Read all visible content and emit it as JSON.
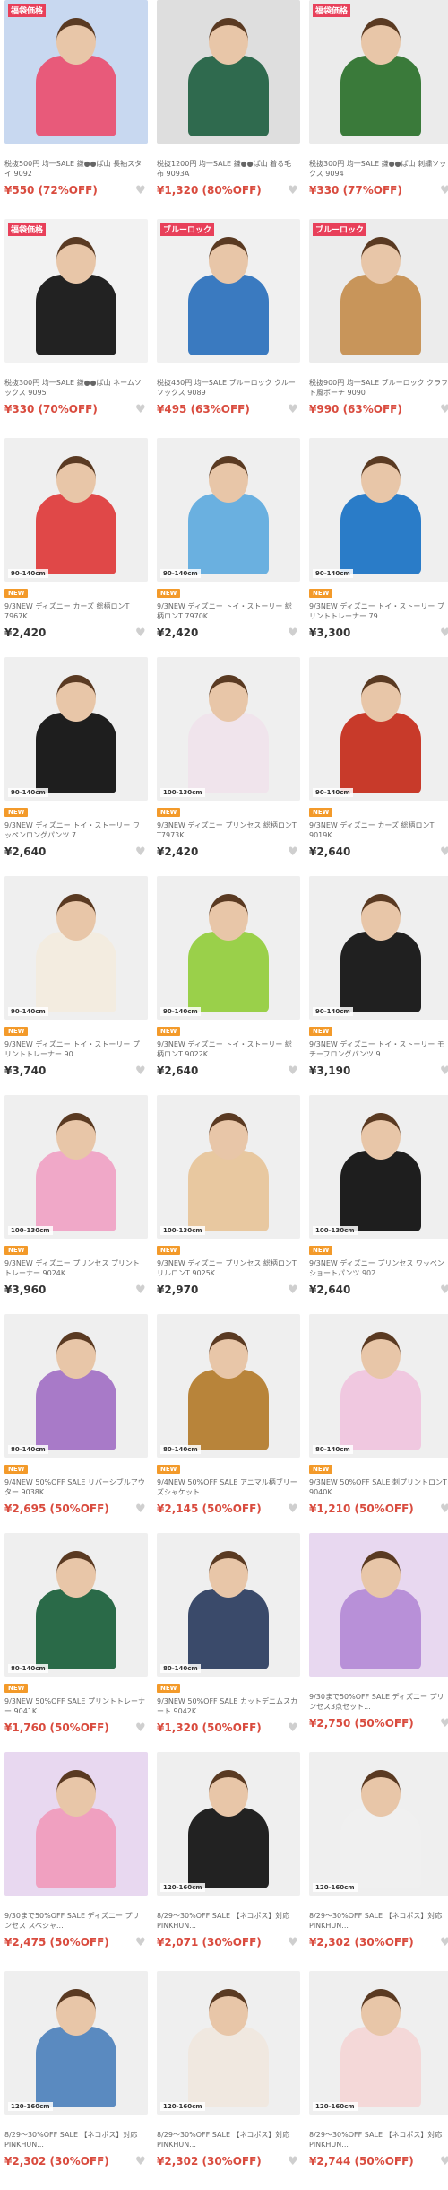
{
  "products": [
    {
      "title": "税抜500円 均一SALE 鎌●●ぱ山 長袖スタイ 9092",
      "price": "¥550 (72%OFF)",
      "sale": true,
      "new": false,
      "size": "",
      "badge_text": "福袋価格",
      "bg": "#c8d8f0",
      "accent": "#e85a7a"
    },
    {
      "title": "税抜1200円 均一SALE 鎌●●ぱ山 着る毛布 9093A",
      "price": "¥1,320 (80%OFF)",
      "sale": true,
      "new": false,
      "size": "",
      "badge_text": "",
      "bg": "#dedede",
      "accent": "#2f6a4e"
    },
    {
      "title": "税抜300円 均一SALE 鎌●●ぱ山 刺繍ソックス 9094",
      "price": "¥330 (77%OFF)",
      "sale": true,
      "new": false,
      "size": "",
      "badge_text": "福袋価格",
      "bg": "#ebebeb",
      "accent": "#3a7a3a"
    },
    {
      "title": "税抜300円 均一SALE 鎌●●ぱ山 ネームソックス 9095",
      "price": "¥330 (70%OFF)",
      "sale": true,
      "new": false,
      "size": "",
      "badge_text": "福袋価格",
      "bg": "#f2f2f2",
      "accent": "#222222"
    },
    {
      "title": "税抜450円 均一SALE ブルーロック クルーソックス 9089",
      "price": "¥495 (63%OFF)",
      "sale": true,
      "new": false,
      "size": "",
      "badge_text": "ブルーロック",
      "bg": "#f0f0f0",
      "accent": "#3a7ac0"
    },
    {
      "title": "税抜900円 均一SALE ブルーロック クラフト風ポーチ 9090",
      "price": "¥990 (63%OFF)",
      "sale": true,
      "new": false,
      "size": "",
      "badge_text": "ブルーロック",
      "bg": "#ececec",
      "accent": "#c8955a"
    },
    {
      "title": "9/3NEW ディズニー カーズ 総柄ロンT 7967K",
      "price": "¥2,420",
      "sale": false,
      "new": true,
      "size": "90-140cm",
      "badge_text": "",
      "bg": "#efefef",
      "accent": "#e04848"
    },
    {
      "title": "9/3NEW ディズニー トイ・ストーリー 総柄ロンT 7970K",
      "price": "¥2,420",
      "sale": false,
      "new": true,
      "size": "90-140cm",
      "badge_text": "",
      "bg": "#efefef",
      "accent": "#6ab0e0"
    },
    {
      "title": "9/3NEW ディズニー トイ・ストーリー プリントトレーナー 79...",
      "price": "¥3,300",
      "sale": false,
      "new": true,
      "size": "90-140cm",
      "badge_text": "",
      "bg": "#efefef",
      "accent": "#2a7cc8"
    },
    {
      "title": "9/3NEW ディズニー トイ・ストーリー ワッペンロングパンツ 7...",
      "price": "¥2,640",
      "sale": false,
      "new": true,
      "size": "90-140cm",
      "badge_text": "",
      "bg": "#efefef",
      "accent": "#1e1e1e"
    },
    {
      "title": "9/3NEW ディズニー プリンセス 総柄ロンT T7973K",
      "price": "¥2,420",
      "sale": false,
      "new": true,
      "size": "100-130cm",
      "badge_text": "",
      "bg": "#efefef",
      "accent": "#f0e4ec"
    },
    {
      "title": "9/3NEW ディズニー カーズ 総柄ロンT 9019K",
      "price": "¥2,640",
      "sale": false,
      "new": true,
      "size": "90-140cm",
      "badge_text": "",
      "bg": "#efefef",
      "accent": "#c83a2a"
    },
    {
      "title": "9/3NEW ディズニー トイ・ストーリー プリントトレーナー 90...",
      "price": "¥3,740",
      "sale": false,
      "new": true,
      "size": "90-140cm",
      "badge_text": "",
      "bg": "#efefef",
      "accent": "#f3ece0"
    },
    {
      "title": "9/3NEW ディズニー トイ・ストーリー 総柄ロンT 9022K",
      "price": "¥2,640",
      "sale": false,
      "new": true,
      "size": "90-140cm",
      "badge_text": "",
      "bg": "#efefef",
      "accent": "#9ad04a"
    },
    {
      "title": "9/3NEW ディズニー トイ・ストーリー モチーフロングパンツ 9...",
      "price": "¥3,190",
      "sale": false,
      "new": true,
      "size": "90-140cm",
      "badge_text": "",
      "bg": "#efefef",
      "accent": "#202020"
    },
    {
      "title": "9/3NEW ディズニー プリンセス プリントトレーナー 9024K",
      "price": "¥3,960",
      "sale": false,
      "new": true,
      "size": "100-130cm",
      "badge_text": "",
      "bg": "#efefef",
      "accent": "#f0a8c8"
    },
    {
      "title": "9/3NEW ディズニー プリンセス 総柄ロンT リルロンT 9025K",
      "price": "¥2,970",
      "sale": false,
      "new": true,
      "size": "100-130cm",
      "badge_text": "",
      "bg": "#efefef",
      "accent": "#e8c8a0"
    },
    {
      "title": "9/3NEW ディズニー プリンセス ワッペンショートパンツ 902...",
      "price": "¥2,640",
      "sale": false,
      "new": true,
      "size": "100-130cm",
      "badge_text": "",
      "bg": "#efefef",
      "accent": "#1e1e1e"
    },
    {
      "title": "9/4NEW 50%OFF SALE リバーシブルアウター 9038K",
      "price": "¥2,695 (50%OFF)",
      "sale": true,
      "new": true,
      "size": "80-140cm",
      "badge_text": "",
      "bg": "#efefef",
      "accent": "#a87ac8"
    },
    {
      "title": "9/4NEW 50%OFF SALE アニマル柄ブリーズシャケット...",
      "price": "¥2,145 (50%OFF)",
      "sale": true,
      "new": true,
      "size": "80-140cm",
      "badge_text": "",
      "bg": "#efefef",
      "accent": "#b8843a"
    },
    {
      "title": "9/3NEW 50%OFF SALE 刺プリントロンT 9040K",
      "price": "¥1,210 (50%OFF)",
      "sale": true,
      "new": true,
      "size": "80-140cm",
      "badge_text": "",
      "bg": "#efefef",
      "accent": "#f0c8e0"
    },
    {
      "title": "9/3NEW 50%OFF SALE プリントトレーナー 9041K",
      "price": "¥1,760 (50%OFF)",
      "sale": true,
      "new": true,
      "size": "80-140cm",
      "badge_text": "",
      "bg": "#efefef",
      "accent": "#2a6a48"
    },
    {
      "title": "9/3NEW 50%OFF SALE カットデニムスカート 9042K",
      "price": "¥1,320 (50%OFF)",
      "sale": true,
      "new": true,
      "size": "80-140cm",
      "badge_text": "",
      "bg": "#efefef",
      "accent": "#3a4a6a"
    },
    {
      "title": "9/30まで50%OFF SALE ディズニー プリンセス3点セット...",
      "price": "¥2,750 (50%OFF)",
      "sale": true,
      "new": false,
      "size": "",
      "badge_text": "",
      "bg": "#e8d8f0",
      "accent": "#b890d8"
    },
    {
      "title": "9/30まで50%OFF SALE ディズニー プリンセス スペシャ...",
      "price": "¥2,475 (50%OFF)",
      "sale": true,
      "new": false,
      "size": "",
      "badge_text": "",
      "bg": "#e8d8f0",
      "accent": "#f0a0c0"
    },
    {
      "title": "8/29〜30%OFF SALE 【ネコポス】対応 PINKHUN...",
      "price": "¥2,071 (30%OFF)",
      "sale": true,
      "new": false,
      "size": "120-160cm",
      "badge_text": "",
      "bg": "#efefef",
      "accent": "#222222"
    },
    {
      "title": "8/29〜30%OFF SALE 【ネコポス】対応 PINKHUN...",
      "price": "¥2,302 (30%OFF)",
      "sale": true,
      "new": false,
      "size": "120-160cm",
      "badge_text": "",
      "bg": "#efefef",
      "accent": "#f0f0f0"
    },
    {
      "title": "8/29〜30%OFF SALE 【ネコポス】対応 PINKHUN...",
      "price": "¥2,302 (30%OFF)",
      "sale": true,
      "new": false,
      "size": "120-160cm",
      "badge_text": "",
      "bg": "#efefef",
      "accent": "#5a8ac0"
    },
    {
      "title": "8/29〜30%OFF SALE 【ネコポス】対応 PINKHUN...",
      "price": "¥2,302 (30%OFF)",
      "sale": true,
      "new": false,
      "size": "120-160cm",
      "badge_text": "",
      "bg": "#efefef",
      "accent": "#f0e8e0"
    },
    {
      "title": "8/29〜30%OFF SALE 【ネコポス】対応 PINKHUN...",
      "price": "¥2,744 (50%OFF)",
      "sale": true,
      "new": false,
      "size": "120-160cm",
      "badge_text": "",
      "bg": "#efefef",
      "accent": "#f4d8d8"
    }
  ],
  "new_label": "NEW",
  "colors": {
    "sale_price": "#d94b3e",
    "regular_price": "#333333",
    "new_badge": "#f39a2a",
    "heart": "#cfcfcf"
  }
}
